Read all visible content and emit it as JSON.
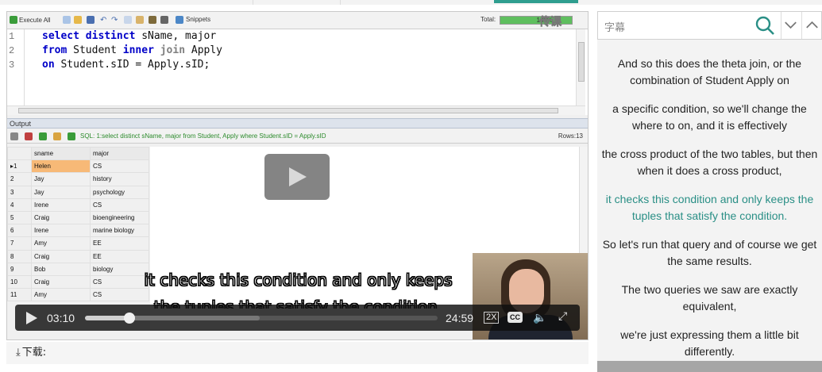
{
  "toolbar": {
    "execute_all": "Execute All",
    "snippets": "Snippets",
    "total_label": "Total:",
    "progress_percent": 100,
    "progress_text": "100%"
  },
  "watermark": "传课",
  "editor": {
    "line_numbers": [
      "1",
      "2",
      "3"
    ],
    "lines": [
      [
        "select distinct",
        " sName, major"
      ],
      [
        "from",
        " Student ",
        "inner",
        " ",
        "join",
        " Apply"
      ],
      [
        "on",
        " Student.sID = Apply.sID;"
      ]
    ]
  },
  "output": {
    "header": "Output",
    "sql_text": "SQL: 1:select distinct sName, major  from Student, Apply  where Student.sID = Apply.sID",
    "rows_label": "Rows:13",
    "columns": [
      "sname",
      "major"
    ],
    "rows": [
      {
        "n": "▸1",
        "sname": "Helen",
        "major": "CS"
      },
      {
        "n": "2",
        "sname": "Jay",
        "major": "history"
      },
      {
        "n": "3",
        "sname": "Jay",
        "major": "psychology"
      },
      {
        "n": "4",
        "sname": "Irene",
        "major": "CS"
      },
      {
        "n": "5",
        "sname": "Craig",
        "major": "bioengineering"
      },
      {
        "n": "6",
        "sname": "Irene",
        "major": "marine biology"
      },
      {
        "n": "7",
        "sname": "Amy",
        "major": "EE"
      },
      {
        "n": "8",
        "sname": "Craig",
        "major": "EE"
      },
      {
        "n": "9",
        "sname": "Bob",
        "major": "biology"
      },
      {
        "n": "10",
        "sname": "Craig",
        "major": "CS"
      },
      {
        "n": "11",
        "sname": "Amy",
        "major": "CS"
      }
    ]
  },
  "subtitle": {
    "line1": "it checks this condition and only keeps",
    "line2": "the tuples that satisfy the condition."
  },
  "player": {
    "current_time": "03:10",
    "duration": "24:59",
    "progress_fraction": 0.127,
    "speed": "2X",
    "cc": "CC"
  },
  "download_label": "下载:",
  "search": {
    "placeholder": "字幕"
  },
  "transcript": [
    {
      "text": "And so this does the theta join, or the combination of Student Apply on",
      "active": false
    },
    {
      "text": "a specific condition, so we'll change the where to on, and it is effectively",
      "active": false
    },
    {
      "text": "the cross product of the two tables, but then when it does a cross product,",
      "active": false
    },
    {
      "text": "it checks this condition and only keeps the tuples that satisfy the condition.",
      "active": true
    },
    {
      "text": "So let's run that query and of course we get the same results.",
      "active": false
    },
    {
      "text": "The two queries we saw are exactly equivalent,",
      "active": false
    },
    {
      "text": "we're just expressing them a little bit differently.",
      "active": false
    }
  ],
  "colors": {
    "accent": "#2a8f86",
    "keyword": "#0000c8",
    "sql_green": "#2b8a2b",
    "selected_cell": "#f7b977"
  }
}
